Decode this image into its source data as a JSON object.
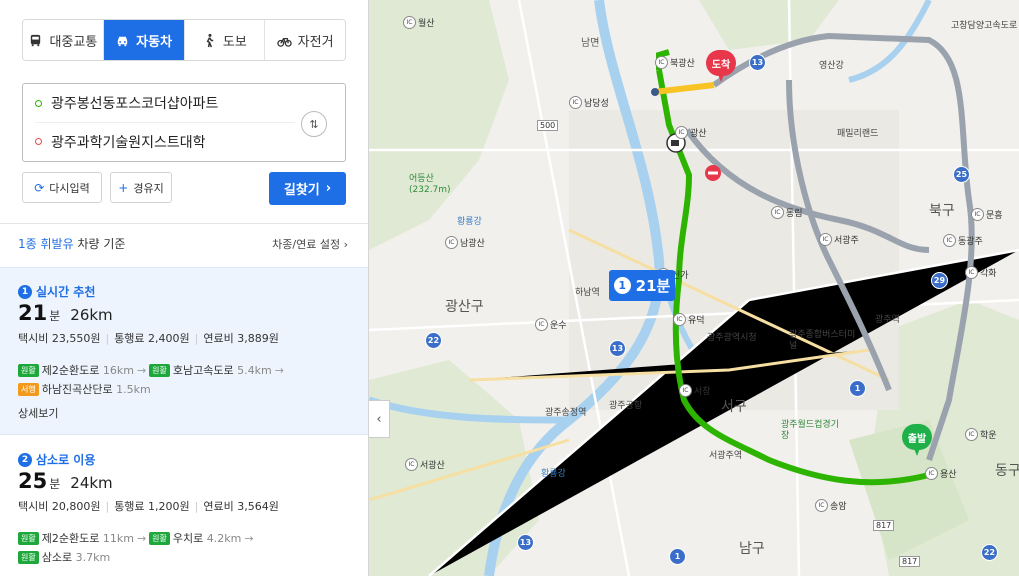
{
  "modes": [
    {
      "label": "대중교통",
      "icon": "bus-icon"
    },
    {
      "label": "자동차",
      "icon": "car-icon",
      "active": true
    },
    {
      "label": "도보",
      "icon": "walk-icon"
    },
    {
      "label": "자전거",
      "icon": "bike-icon"
    }
  ],
  "route": {
    "start": "광주봉선동포스코더샵아파트",
    "end": "광주과학기술원지스트대학"
  },
  "buttons": {
    "reset": "다시입력",
    "via": "경유지",
    "search": "길찾기"
  },
  "criteria": {
    "fuel": "1종 휘발유",
    "suffix": "차량 기준",
    "settings": "차종/연료 설정"
  },
  "results": [
    {
      "num": "1",
      "title": "실시간 추천",
      "time": "21",
      "time_unit": "분",
      "distance": "26km",
      "taxi": "택시비 23,550원",
      "toll": "통행료 2,400원",
      "fuel": "연료비 3,889원",
      "roads": [
        {
          "tag": "원활",
          "tag_color": "green",
          "name": "제2순환도로",
          "dist": "16km"
        },
        {
          "tag": "원활",
          "tag_color": "green",
          "name": "호남고속도로",
          "dist": "5.4km"
        },
        {
          "tag": "서행",
          "tag_color": "orange",
          "name": "하남진곡산단로",
          "dist": "1.5km"
        }
      ],
      "detail": "상세보기"
    },
    {
      "num": "2",
      "title": "삼소로 이용",
      "time": "25",
      "time_unit": "분",
      "distance": "24km",
      "taxi": "택시비 20,800원",
      "toll": "통행료 1,200원",
      "fuel": "연료비 3,564원",
      "roads": [
        {
          "tag": "원활",
          "tag_color": "green",
          "name": "제2순환도로",
          "dist": "11km"
        },
        {
          "tag": "원활",
          "tag_color": "green",
          "name": "우치로",
          "dist": "4.2km"
        },
        {
          "tag": "원활",
          "tag_color": "green",
          "name": "삼소로",
          "dist": "3.7km"
        }
      ]
    }
  ],
  "map": {
    "badge": {
      "num": "1",
      "time": "21분"
    },
    "pins": {
      "end": "도착",
      "start": "출발"
    },
    "districts": [
      "광산구",
      "서구",
      "북구",
      "남구",
      "동구",
      "남면"
    ],
    "places": [
      "하남역",
      "광주공항",
      "광주송정역",
      "서광주역",
      "광주광역시청",
      "광주종합버스터미널",
      "광주월드컵경기장",
      "광주역",
      "영산강",
      "패밀리랜드",
      "어등산(232.7m)",
      "고창담양고속도로"
    ],
    "rivers": [
      "황룡강",
      "황룡강",
      "영산강"
    ],
    "ics": [
      "월산",
      "북광산",
      "남광산",
      "신가",
      "유덕",
      "서창",
      "운수",
      "서광산",
      "동림",
      "서광주",
      "문흥",
      "동광주",
      "각화",
      "학운",
      "용산",
      "송암",
      "광산",
      "남당성"
    ],
    "shields": [
      "13",
      "500",
      "25",
      "22",
      "13",
      "1",
      "29",
      "817",
      "817",
      "13",
      "22",
      "1"
    ],
    "colors": {
      "route": "#2db400",
      "slow": "#f7c325",
      "alt_route": "#9aa3ad",
      "accent": "#1e6ee6"
    }
  }
}
